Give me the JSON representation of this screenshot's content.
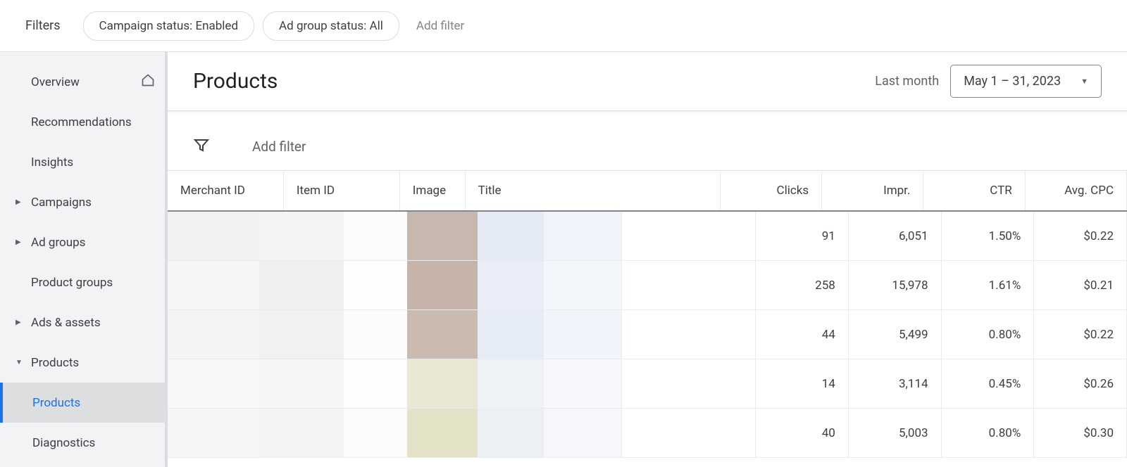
{
  "filters": {
    "label": "Filters",
    "chips": [
      "Campaign status: Enabled",
      "Ad group status: All"
    ],
    "add_filter": "Add filter"
  },
  "sidebar": {
    "items": [
      {
        "label": "Overview",
        "has_home": true
      },
      {
        "label": "Recommendations"
      },
      {
        "label": "Insights"
      },
      {
        "label": "Campaigns",
        "expandable": true
      },
      {
        "label": "Ad groups",
        "expandable": true
      },
      {
        "label": "Product groups"
      },
      {
        "label": "Ads & assets",
        "expandable": true
      },
      {
        "label": "Products",
        "expandable": true,
        "expanded": true
      }
    ],
    "sub_items": [
      {
        "label": "Products",
        "active": true
      },
      {
        "label": "Diagnostics"
      }
    ]
  },
  "header": {
    "title": "Products",
    "date_label": "Last month",
    "date_range": "May 1 – 31, 2023"
  },
  "table_filter": {
    "add_filter": "Add filter"
  },
  "table": {
    "columns": {
      "merchant": "Merchant ID",
      "item": "Item ID",
      "image": "Image",
      "title": "Title",
      "clicks": "Clicks",
      "impr": "Impr.",
      "ctr": "CTR",
      "cpc": "Avg. CPC"
    },
    "rows": [
      {
        "clicks": "91",
        "impr": "6,051",
        "ctr": "1.50%",
        "cpc": "$0.22",
        "redact": [
          "#f1f1f1",
          "#f3f4f6",
          "#fafbfd",
          "#c8b7ae",
          "#e4eaf6",
          "#eff3fa"
        ]
      },
      {
        "clicks": "258",
        "impr": "15,978",
        "ctr": "1.61%",
        "cpc": "$0.21",
        "redact": [
          "#f6f6f6",
          "#efeff0",
          "#fdfdfe",
          "#c6b3a9",
          "#e8edf7",
          "#f3f6fb"
        ]
      },
      {
        "clicks": "44",
        "impr": "5,499",
        "ctr": "0.80%",
        "cpc": "$0.22",
        "redact": [
          "#f4f4f4",
          "#f1f1f2",
          "#fcfcfd",
          "#cbbab0",
          "#e6ecf6",
          "#f1f5fb"
        ]
      },
      {
        "clicks": "14",
        "impr": "3,114",
        "ctr": "0.45%",
        "cpc": "$0.26",
        "redact": [
          "#f7f7f7",
          "#f6f6f6",
          "#fdfdfd",
          "#e8e7d4",
          "#eef1f5",
          "#f6f8fb"
        ]
      },
      {
        "clicks": "40",
        "impr": "5,003",
        "ctr": "0.80%",
        "cpc": "$0.30",
        "redact": [
          "#f6f6f6",
          "#f4f4f4",
          "#fcfcfc",
          "#e3e1c6",
          "#ecf0f5",
          "#f5f7fb"
        ]
      }
    ]
  }
}
